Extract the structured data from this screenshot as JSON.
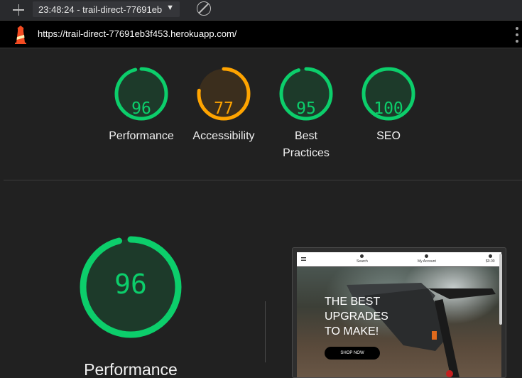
{
  "toolbar": {
    "report_label": "23:48:24 - trail-direct-77691eb",
    "caret": "▼"
  },
  "urlbar": {
    "url": "https://trail-direct-77691eb3f453.herokuapp.com/"
  },
  "scores": [
    {
      "label": "Performance",
      "value": "96",
      "score": 0.96,
      "color": "#0cce6b"
    },
    {
      "label": "Accessibility",
      "value": "77",
      "score": 0.77,
      "color": "#ffa400"
    },
    {
      "label": "Best Practices",
      "value": "95",
      "score": 0.95,
      "color": "#0cce6b"
    },
    {
      "label": "SEO",
      "value": "100",
      "score": 1.0,
      "color": "#0cce6b"
    }
  ],
  "detail": {
    "value": "96",
    "score": 0.96,
    "label": "Performance",
    "color": "#0cce6b"
  },
  "screenshot": {
    "nav_search": "Search",
    "nav_account": "My Account",
    "nav_cart": "$0.00",
    "hero_line1": "THE BEST",
    "hero_line2": "UPGRADES",
    "hero_line3": "TO MAKE!",
    "shop_button": "SHOP NOW"
  },
  "colors": {
    "pass": "#0cce6b",
    "average": "#ffa400",
    "background": "#212121"
  }
}
